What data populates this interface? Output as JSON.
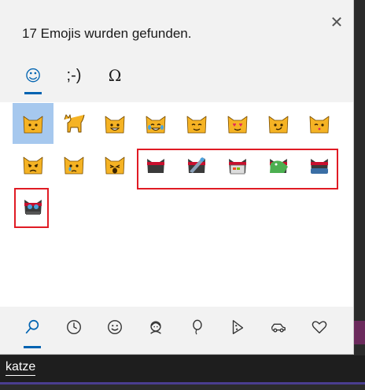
{
  "panel": {
    "title": "17 Emojis wurden gefunden.",
    "close_glyph": "✕"
  },
  "category_tabs": [
    {
      "name": "emoji",
      "icon": "smiley-face-icon",
      "glyph": "☺",
      "active": true
    },
    {
      "name": "kaomoji",
      "glyph": ";-)",
      "active": false
    },
    {
      "name": "symbols",
      "glyph": "Ω",
      "active": false
    }
  ],
  "emoji_results": [
    {
      "desc": "cat face",
      "variant": "plain",
      "selected": true
    },
    {
      "desc": "cat",
      "variant": "cat-body"
    },
    {
      "desc": "grinning cat",
      "variant": "grin"
    },
    {
      "desc": "cat with tears of joy",
      "variant": "joy"
    },
    {
      "desc": "smiling cat",
      "variant": "smile"
    },
    {
      "desc": "smiling cat with heart-eyes",
      "variant": "hearts"
    },
    {
      "desc": "cat with wry smile",
      "variant": "wry"
    },
    {
      "desc": "kissing cat",
      "variant": "kiss"
    },
    {
      "desc": "pouting cat",
      "variant": "pout"
    },
    {
      "desc": "crying cat",
      "variant": "cry"
    },
    {
      "desc": "weary cat",
      "variant": "weary"
    },
    {
      "desc": "ninja cat",
      "variant": "ninja"
    },
    {
      "desc": "astro ninja cat",
      "variant": "astro"
    },
    {
      "desc": "hacker ninja cat",
      "variant": "hacker"
    },
    {
      "desc": "dino ninja cat",
      "variant": "dino"
    },
    {
      "desc": "stunt ninja cat",
      "variant": "stunt"
    },
    {
      "desc": "hipster ninja cat",
      "variant": "hipster"
    }
  ],
  "bottom_tabs": [
    {
      "name": "search",
      "icon": "search-icon",
      "active": true
    },
    {
      "name": "recent",
      "icon": "clock-icon"
    },
    {
      "name": "smileys",
      "icon": "smiley-icon"
    },
    {
      "name": "people",
      "icon": "person-icon"
    },
    {
      "name": "celebration",
      "icon": "balloon-icon"
    },
    {
      "name": "food",
      "icon": "pizza-icon"
    },
    {
      "name": "travel",
      "icon": "car-icon"
    },
    {
      "name": "symbols",
      "icon": "heart-icon"
    }
  ],
  "typed_text": "katze",
  "colors": {
    "accent": "#0063b1",
    "highlight_border": "#e01b24",
    "selected_cell": "#a6c8ee",
    "cat_yellow": "#f5b324",
    "ninja_dark": "#3a3a3a"
  }
}
